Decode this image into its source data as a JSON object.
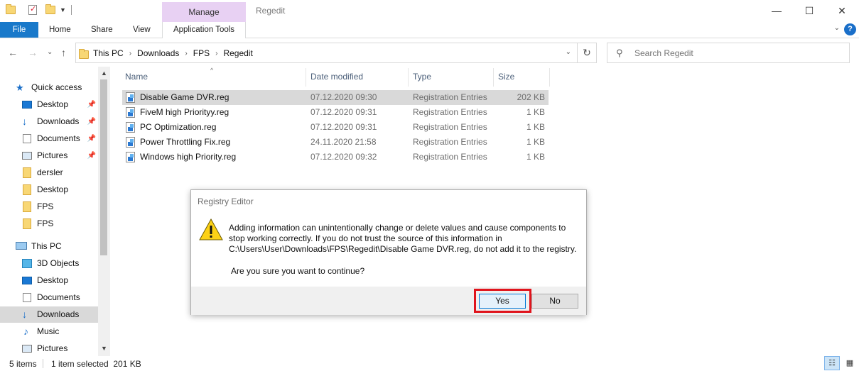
{
  "titlebar": {
    "context_tab": "Manage",
    "window_title": "Regedit",
    "minimize": "—",
    "maximize": "☐",
    "close": "✕"
  },
  "ribbon": {
    "tabs": [
      "File",
      "Home",
      "Share",
      "View",
      "Application Tools"
    ],
    "collapse": "⌄",
    "help": "?"
  },
  "address": {
    "back": "←",
    "forward": "→",
    "recent": "⌄",
    "up": "↑",
    "crumbs": [
      "This PC",
      "Downloads",
      "FPS",
      "Regedit"
    ],
    "crumb_sep": "›",
    "dropdown": "⌄",
    "refresh": "↻"
  },
  "search": {
    "placeholder": "Search Regedit",
    "icon": "⚲"
  },
  "nav": {
    "quick_access": "Quick access",
    "quick_items": [
      {
        "label": "Desktop",
        "icon": "desktop-icon",
        "pinned": true
      },
      {
        "label": "Downloads",
        "icon": "download-icon",
        "pinned": true
      },
      {
        "label": "Documents",
        "icon": "documents-icon",
        "pinned": true
      },
      {
        "label": "Pictures",
        "icon": "pictures-icon",
        "pinned": true
      },
      {
        "label": "dersler",
        "icon": "folder-icon",
        "pinned": false
      },
      {
        "label": "Desktop",
        "icon": "folder-icon",
        "pinned": false
      },
      {
        "label": "FPS",
        "icon": "folder-icon",
        "pinned": false
      },
      {
        "label": "FPS",
        "icon": "folder-icon",
        "pinned": false
      }
    ],
    "this_pc": "This PC",
    "pc_items": [
      {
        "label": "3D Objects",
        "icon": "3d-objects-icon"
      },
      {
        "label": "Desktop",
        "icon": "desktop-icon"
      },
      {
        "label": "Documents",
        "icon": "documents-icon"
      },
      {
        "label": "Downloads",
        "icon": "download-icon",
        "selected": true
      },
      {
        "label": "Music",
        "icon": "music-icon"
      },
      {
        "label": "Pictures",
        "icon": "pictures-icon"
      }
    ],
    "pin_glyph": "📌",
    "scroll_up": "▲",
    "scroll_down": "▼"
  },
  "columns": {
    "name": "Name",
    "date": "Date modified",
    "type": "Type",
    "size": "Size",
    "sort_glyph": "^"
  },
  "files": [
    {
      "name": "Disable Game DVR.reg",
      "date": "07.12.2020 09:30",
      "type": "Registration Entries",
      "size": "202 KB",
      "selected": true
    },
    {
      "name": "FiveM high Priorityy.reg",
      "date": "07.12.2020 09:31",
      "type": "Registration Entries",
      "size": "1 KB"
    },
    {
      "name": "PC Optimization.reg",
      "date": "07.12.2020 09:31",
      "type": "Registration Entries",
      "size": "1 KB"
    },
    {
      "name": "Power Throttling Fix.reg",
      "date": "24.11.2020 21:58",
      "type": "Registration Entries",
      "size": "1 KB"
    },
    {
      "name": "Windows high Priority.reg",
      "date": "07.12.2020 09:32",
      "type": "Registration Entries",
      "size": "1 KB"
    }
  ],
  "status": {
    "items_count": "5 items",
    "selection": "1 item selected  201 KB",
    "view_details": "☷",
    "view_tiles": "▦"
  },
  "dialog": {
    "title": "Registry Editor",
    "message_lines": [
      "Adding information can unintentionally change or delete values and cause components to",
      "stop working correctly. If you do not trust the source of this information in",
      "C:\\Users\\User\\Downloads\\FPS\\Regedit\\Disable Game DVR.reg, do not add it to the registry."
    ],
    "question": "Are you sure you want to continue?",
    "yes_label": "Yes",
    "no_label": "No",
    "highlight_color": "#e0141c"
  }
}
